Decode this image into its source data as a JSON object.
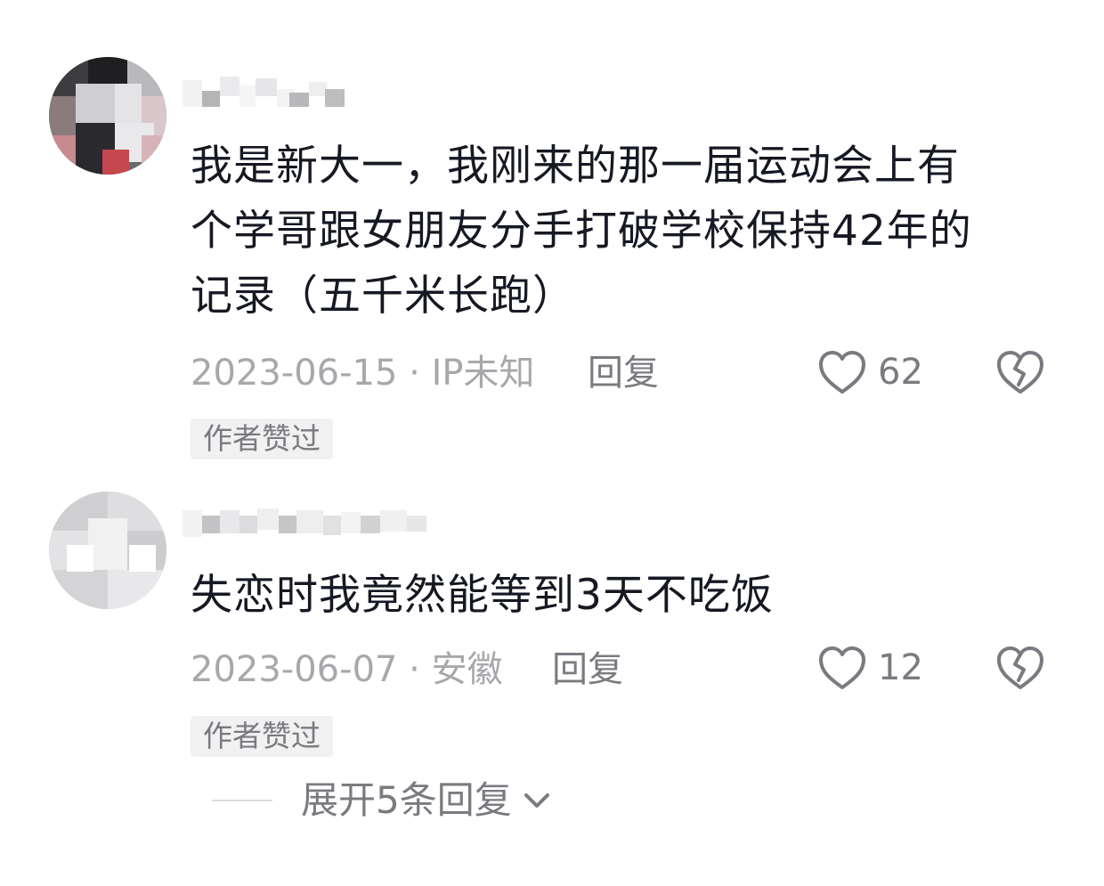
{
  "comments": [
    {
      "text_lines": [
        "我是新大一，我刚来的那一届运动会上有",
        "个学哥跟女朋友分手打破学校保持42年的",
        "记录（五千米长跑）"
      ],
      "date_location": "2023-06-15 · IP未知",
      "reply_label": "回复",
      "likes": "62",
      "badge": "作者赞过",
      "icons": {
        "like": "heart-outline-icon",
        "dislike": "broken-heart-icon"
      }
    },
    {
      "text_lines": [
        "失恋时我竟然能等到3天不吃饭"
      ],
      "date_location": "2023-06-07 · 安徽",
      "reply_label": "回复",
      "likes": "12",
      "badge": "作者赞过",
      "icons": {
        "like": "heart-outline-icon",
        "dislike": "broken-heart-icon"
      }
    }
  ],
  "expand_replies": {
    "label": "展开5条回复",
    "icon": "chevron-down-icon"
  },
  "colors": {
    "text": "#161823",
    "meta": "#a8a8ac",
    "secondary": "#7a7a80",
    "badge_bg": "#f1f1f2"
  }
}
